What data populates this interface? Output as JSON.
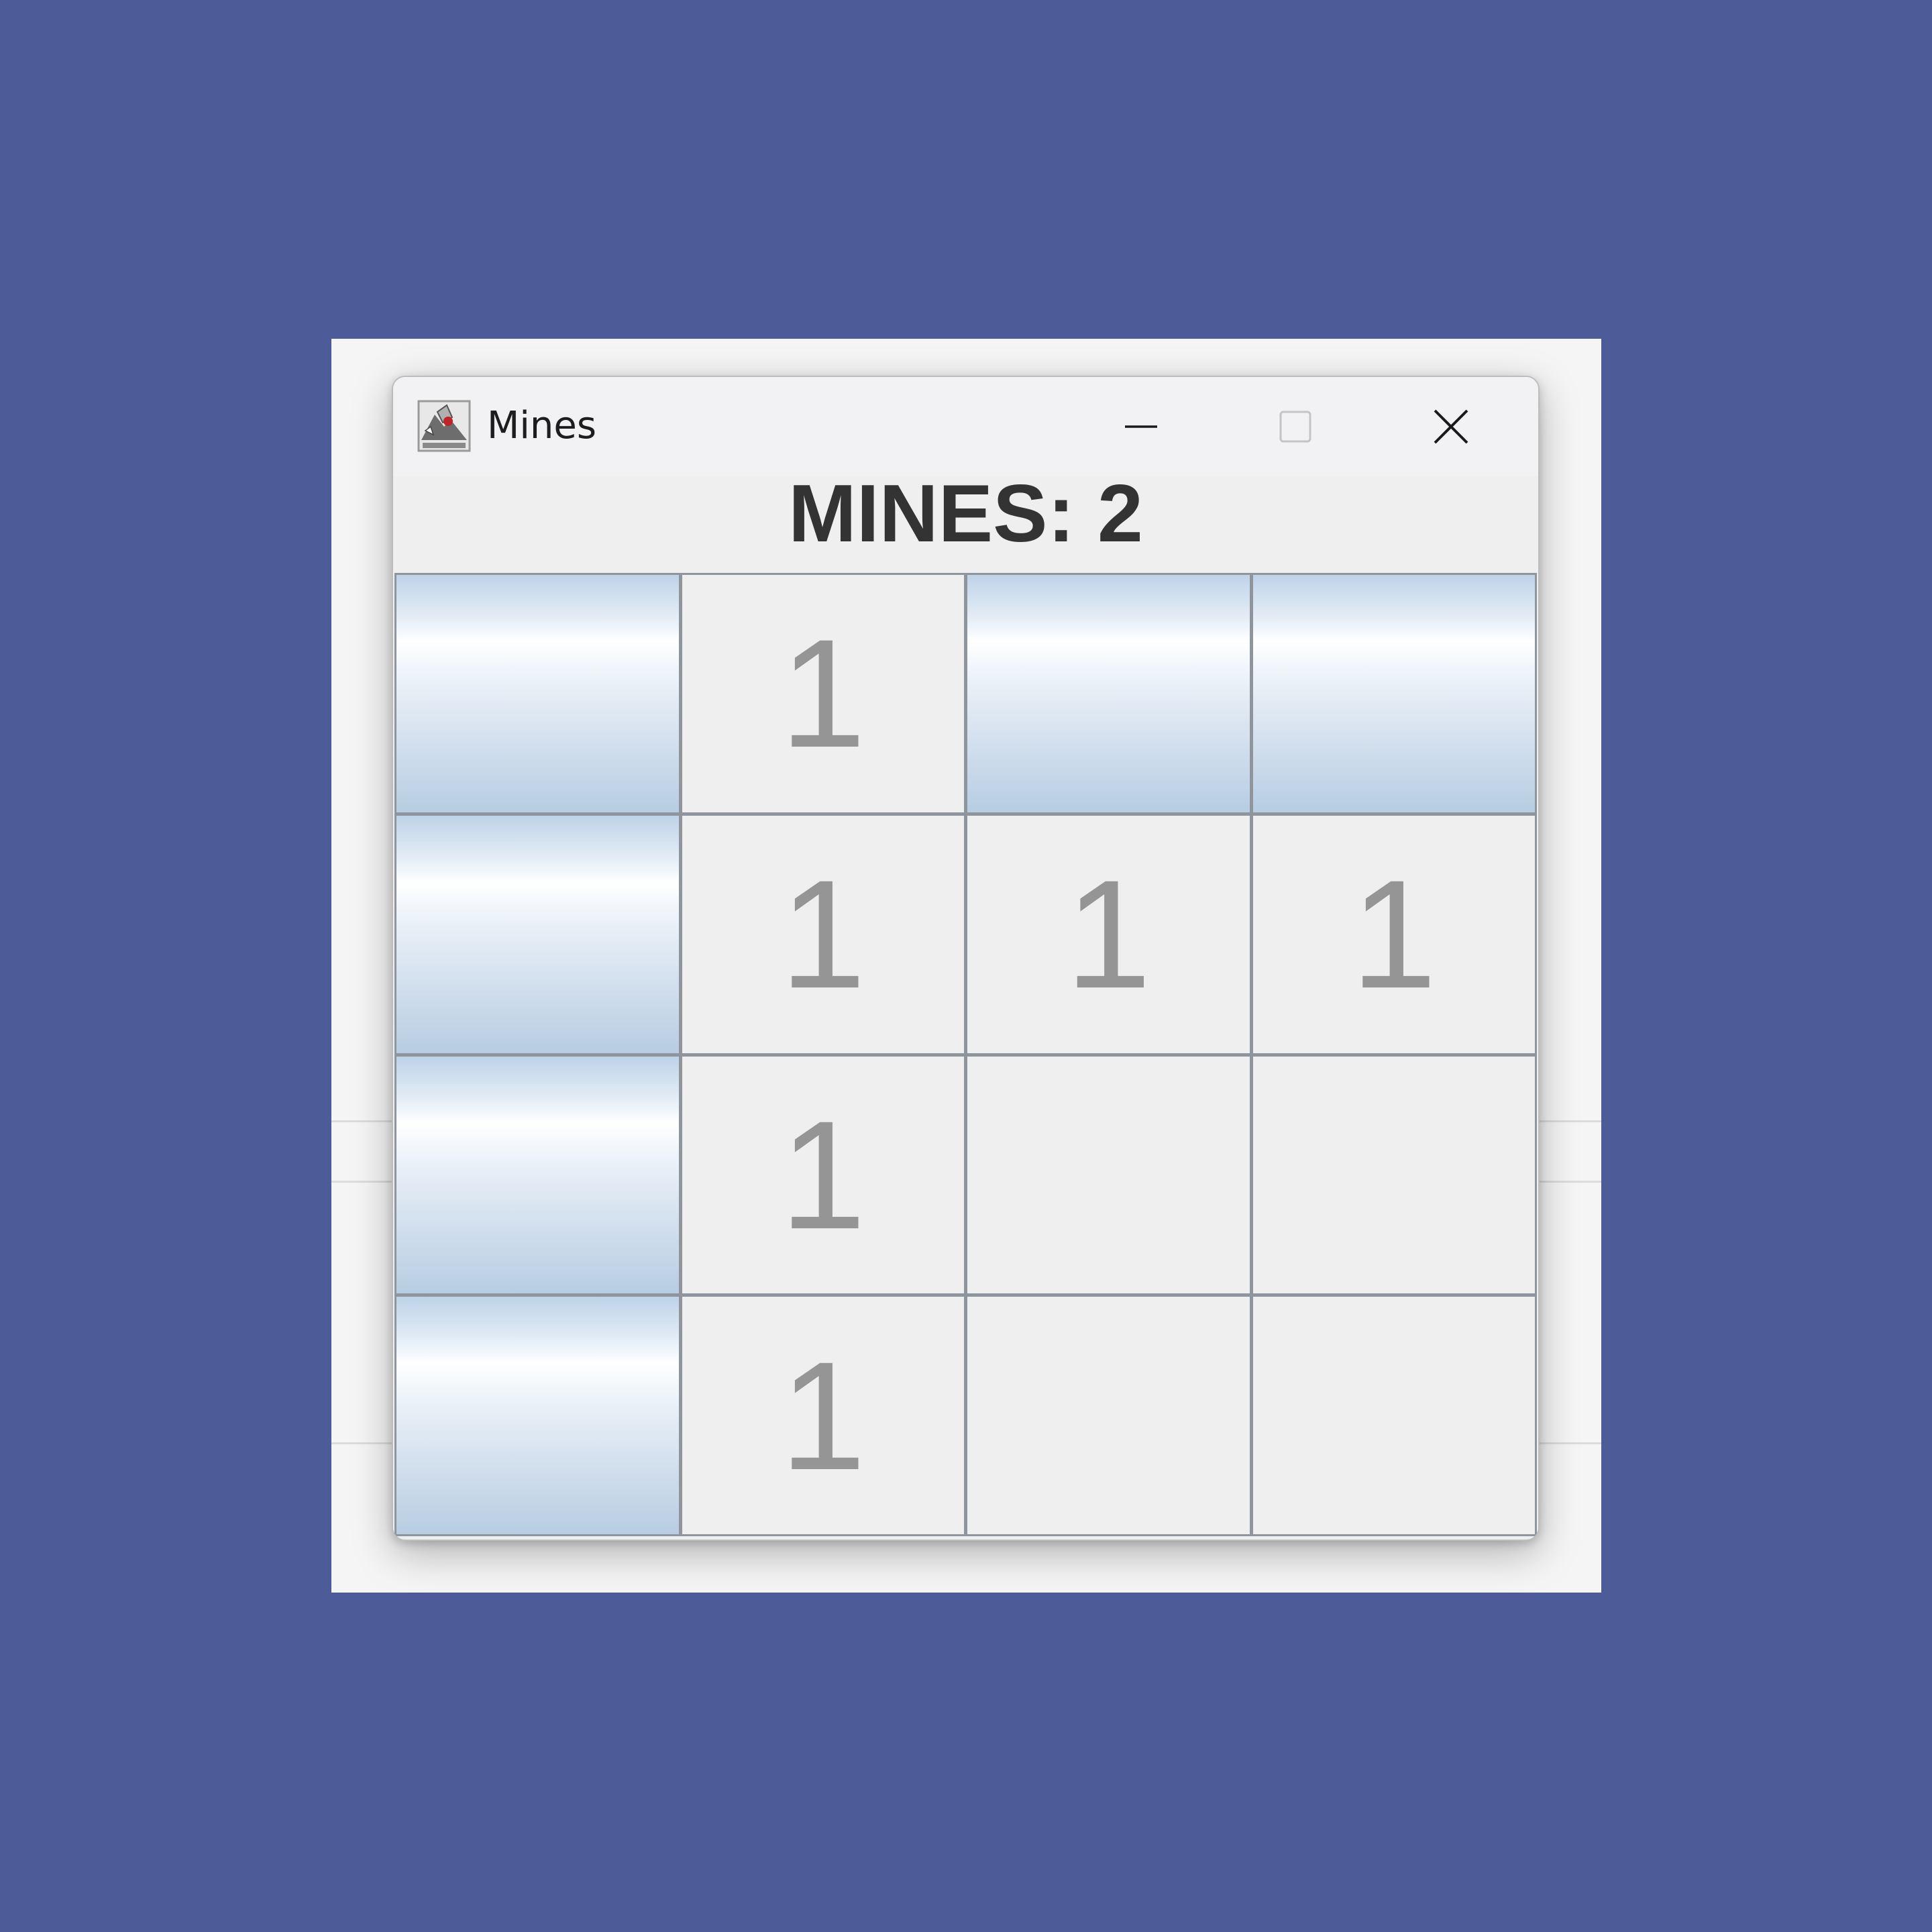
{
  "window": {
    "title": "Mines",
    "controls": {
      "minimize": "minimize-icon",
      "maximize": "maximize-icon",
      "close": "close-icon"
    }
  },
  "status": {
    "mines_label": "MINES: 2"
  },
  "board": {
    "rows": 4,
    "cols": 4,
    "cells": [
      [
        {
          "state": "hidden",
          "value": ""
        },
        {
          "state": "revealed",
          "value": "1"
        },
        {
          "state": "hidden",
          "value": ""
        },
        {
          "state": "hidden",
          "value": ""
        }
      ],
      [
        {
          "state": "hidden",
          "value": ""
        },
        {
          "state": "revealed",
          "value": "1"
        },
        {
          "state": "revealed",
          "value": "1"
        },
        {
          "state": "revealed",
          "value": "1"
        }
      ],
      [
        {
          "state": "hidden",
          "value": ""
        },
        {
          "state": "revealed",
          "value": "1"
        },
        {
          "state": "revealed",
          "value": ""
        },
        {
          "state": "revealed",
          "value": ""
        }
      ],
      [
        {
          "state": "hidden",
          "value": ""
        },
        {
          "state": "revealed",
          "value": "1"
        },
        {
          "state": "revealed",
          "value": ""
        },
        {
          "state": "revealed",
          "value": ""
        }
      ]
    ]
  },
  "colors": {
    "desktop": "#4e5b99",
    "number": "#959595",
    "revealed_cell": "#efefef",
    "hidden_cell_top": "#bed3e7",
    "hidden_cell_highlight": "#ffffff"
  }
}
